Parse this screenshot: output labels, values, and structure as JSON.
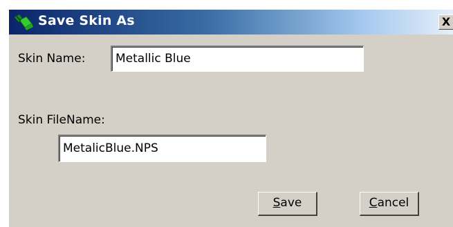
{
  "window": {
    "title": "Save Skin As",
    "close_glyph": "X",
    "icon": "paint-bucket-icon"
  },
  "form": {
    "skin_name_label": "Skin Name:",
    "skin_name_value": "Metallic Blue",
    "skin_filename_label": "Skin FileName:",
    "skin_filename_value": "MetalicBlue.NPS"
  },
  "buttons": {
    "save_accel": "S",
    "save_rest": "ave",
    "cancel_accel": "C",
    "cancel_rest": "ancel"
  },
  "colors": {
    "title_start": "#0a246a",
    "title_end": "#e6eef8",
    "dialog_face": "#d4d0c8"
  }
}
